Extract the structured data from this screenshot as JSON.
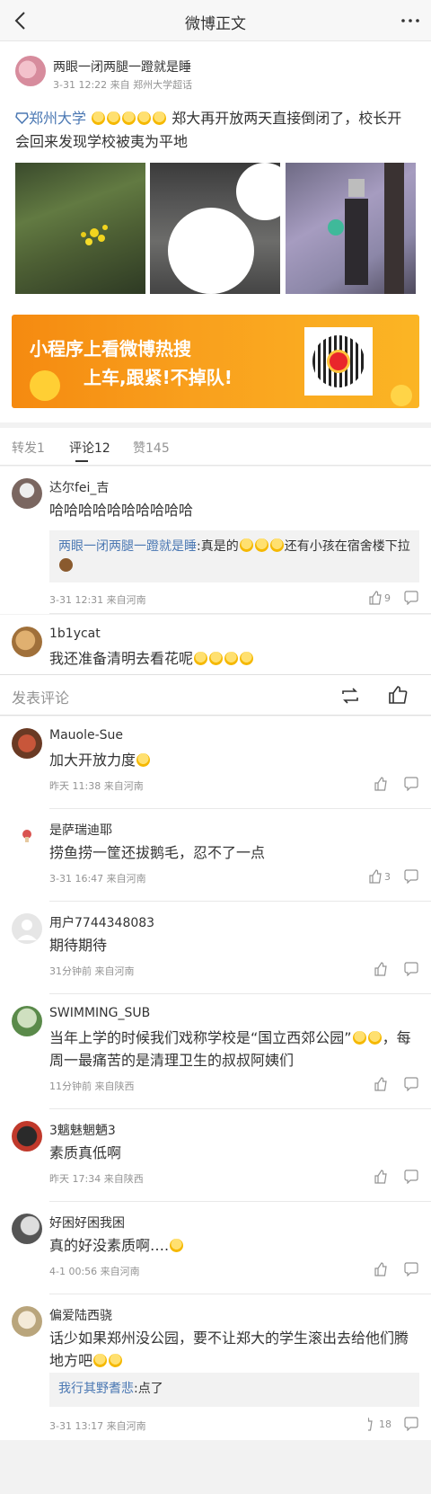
{
  "topbar": {
    "title": "微博正文"
  },
  "post": {
    "username": "两眼一闭两腿一蹬就是睡",
    "meta": "3-31 12:22 来自 郑州大学超话",
    "topic": "郑州大学",
    "text": "郑大再开放两天直接倒闭了，校长开会回来发现学校被夷为平地"
  },
  "banner": {
    "line1": "小程序上看微博热搜",
    "line2": "上车,跟紧!不掉队!"
  },
  "tabs": {
    "repost": "转发1",
    "comment": "评论12",
    "like": "赞145"
  },
  "composer": {
    "placeholder": "发表评论"
  },
  "comments": [
    {
      "name": "达尔fei_吉",
      "body": "哈哈哈哈哈哈哈哈哈哈",
      "sub_who": "两眼一闭两腿一蹬就是睡",
      "sub_text": ":真是的",
      "sub_text2": "还有小孩在宿舍楼下拉",
      "time": "3-31 12:31 来自河南",
      "likes": "9"
    },
    {
      "name": "1b1ycat",
      "body": "我还准备清明去看花呢"
    },
    {
      "name": "Mauole-Sue",
      "body": "加大开放力度",
      "time": "昨天 11:38 来自河南"
    },
    {
      "name": "是萨瑞迪耶",
      "body": "捞鱼捞一筐还拔鹅毛，忍不了一点",
      "time": "3-31 16:47 来自河南",
      "likes": "3"
    },
    {
      "name": "用户7744348083",
      "body": "期待期待",
      "time": "31分钟前 来自河南"
    },
    {
      "name": "SWIMMING_SUB",
      "body": "当年上学的时候我们戏称学校是“国立西郊公园”",
      "body2": "，每周一最痛苦的是清理卫生的叔叔阿姨们",
      "time": "11分钟前 来自陕西"
    },
    {
      "name": "3魑魅魍魉3",
      "body": "素质真低啊",
      "time": "昨天 17:34 来自陕西"
    },
    {
      "name": "好困好困我困",
      "body": "真的好没素质啊….",
      "time": "4-1 00:56 来自河南"
    },
    {
      "name": "偏爱陆西骁",
      "body": "话少如果郑州没公园，要不让郑大的学生滚出去给他们腾地方吧",
      "sub_who": "我行其野耆悲",
      "sub_text": ":点了",
      "time": "3-31 13:17 来自河南",
      "likes": "18"
    }
  ],
  "colors": {
    "link": "#4b78b3",
    "accent": "#f9a01d",
    "meta": "#939393"
  }
}
